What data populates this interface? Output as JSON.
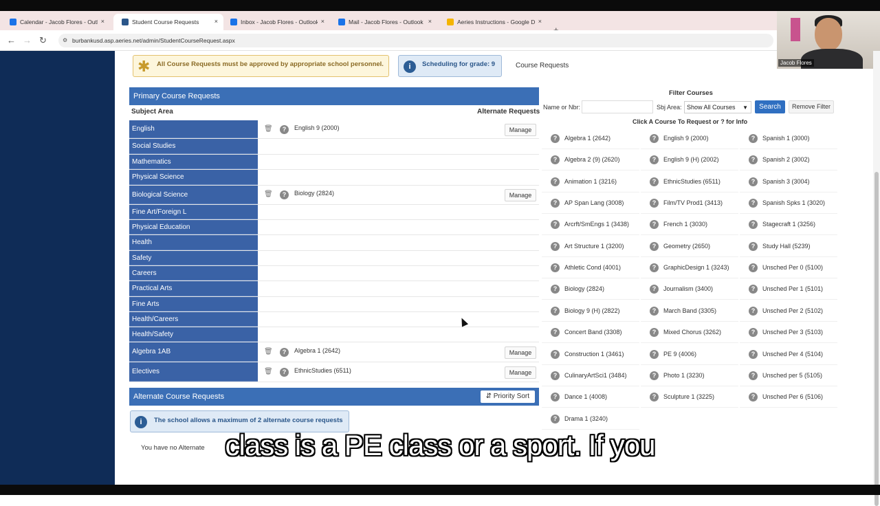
{
  "browser": {
    "tabs": [
      {
        "label": "Calendar - Jacob Flores - Outlo",
        "icon": "outlook-icon",
        "color": "#1a73e8"
      },
      {
        "label": "Student Course Requests",
        "icon": "aeries-icon",
        "color": "#2a568a"
      },
      {
        "label": "Inbox - Jacob Flores - Outlook",
        "icon": "outlook-icon",
        "color": "#1a73e8"
      },
      {
        "label": "Mail - Jacob Flores - Outlook",
        "icon": "outlook-icon",
        "color": "#1a73e8"
      },
      {
        "label": "Aeries Instructions - Google Do",
        "icon": "drive-icon",
        "color": "#f4b400"
      }
    ],
    "new_tab": "+",
    "url": "burbankusd.asp.aeries.net/admin/StudentCourseRequest.aspx"
  },
  "webcam": {
    "name": "Jacob Flores"
  },
  "notices": {
    "approval": "All Course Requests must be approved by appropriate school personnel.",
    "scheduling": "Scheduling for grade: 9",
    "course_requests_link": "Course Requests"
  },
  "primary": {
    "title": "Primary Course Requests",
    "subject_area_header": "Subject Area",
    "alternate_header": "Alternate Requests",
    "manage_label": "Manage",
    "rows": [
      {
        "subject": "English",
        "course": "English 9 (2000)"
      },
      {
        "subject": "Social Studies",
        "course": ""
      },
      {
        "subject": "Mathematics",
        "course": ""
      },
      {
        "subject": "Physical Science",
        "course": ""
      },
      {
        "subject": "Biological Science",
        "course": "Biology (2824)"
      },
      {
        "subject": "Fine Art/Foreign L",
        "course": ""
      },
      {
        "subject": "Physical Education",
        "course": ""
      },
      {
        "subject": "Health",
        "course": ""
      },
      {
        "subject": "Safety",
        "course": ""
      },
      {
        "subject": "Careers",
        "course": ""
      },
      {
        "subject": "Practical Arts",
        "course": ""
      },
      {
        "subject": "Fine Arts",
        "course": ""
      },
      {
        "subject": "Health/Careers",
        "course": ""
      },
      {
        "subject": "Health/Safety",
        "course": ""
      },
      {
        "subject": "Algebra 1AB",
        "course": "Algebra 1 (2642)"
      },
      {
        "subject": "Electives",
        "course": "EthnicStudies (6511)"
      }
    ]
  },
  "alternate": {
    "title": "Alternate Course Requests",
    "priority_sort": "Priority Sort",
    "max_note": "The school allows a maximum of 2 alternate course requests",
    "none_text": "You have no Alternate"
  },
  "filter": {
    "title": "Filter Courses",
    "name_label": "Name or Nbr:",
    "name_value": "",
    "sbj_label": "Sbj Area:",
    "sbj_value": "Show All Courses",
    "search_label": "Search",
    "remove_label": "Remove Filter",
    "hint": "Click A Course To Request or ? for Info"
  },
  "courses": [
    [
      "Algebra 1 (2642)",
      "English 9 (2000)",
      "Spanish 1 (3000)"
    ],
    [
      "Algebra 2 (9) (2620)",
      "English 9 (H) (2002)",
      "Spanish 2 (3002)"
    ],
    [
      "Animation 1 (3216)",
      "EthnicStudies (6511)",
      "Spanish 3 (3004)"
    ],
    [
      "AP Span Lang (3008)",
      "Film/TV Prod1 (3413)",
      "Spanish Spks 1 (3020)"
    ],
    [
      "Arcrft/SmEngs 1 (3438)",
      "French 1 (3030)",
      "Stagecraft 1 (3256)"
    ],
    [
      "Art Structure 1 (3200)",
      "Geometry (2650)",
      "Study Hall (5239)"
    ],
    [
      "Athletic Cond (4001)",
      "GraphicDesign 1 (3243)",
      "Unsched Per 0 (5100)"
    ],
    [
      "Biology (2824)",
      "Journalism (3400)",
      "Unsched Per 1 (5101)"
    ],
    [
      "Biology 9 (H) (2822)",
      "March Band (3305)",
      "Unsched Per 2 (5102)"
    ],
    [
      "Concert Band (3308)",
      "Mixed Chorus (3262)",
      "Unsched Per 3 (5103)"
    ],
    [
      "Construction 1 (3461)",
      "PE 9 (4006)",
      "Unsched Per 4 (5104)"
    ],
    [
      "CulinaryArtSci1 (3484)",
      "Photo 1 (3230)",
      "Unsched per 5 (5105)"
    ],
    [
      "Dance 1 (4008)",
      "Sculpture 1 (3225)",
      "Unsched Per 6 (5106)"
    ],
    [
      "Drama 1 (3240)",
      "",
      ""
    ]
  ],
  "caption": "class is a PE class or a sport. If you"
}
